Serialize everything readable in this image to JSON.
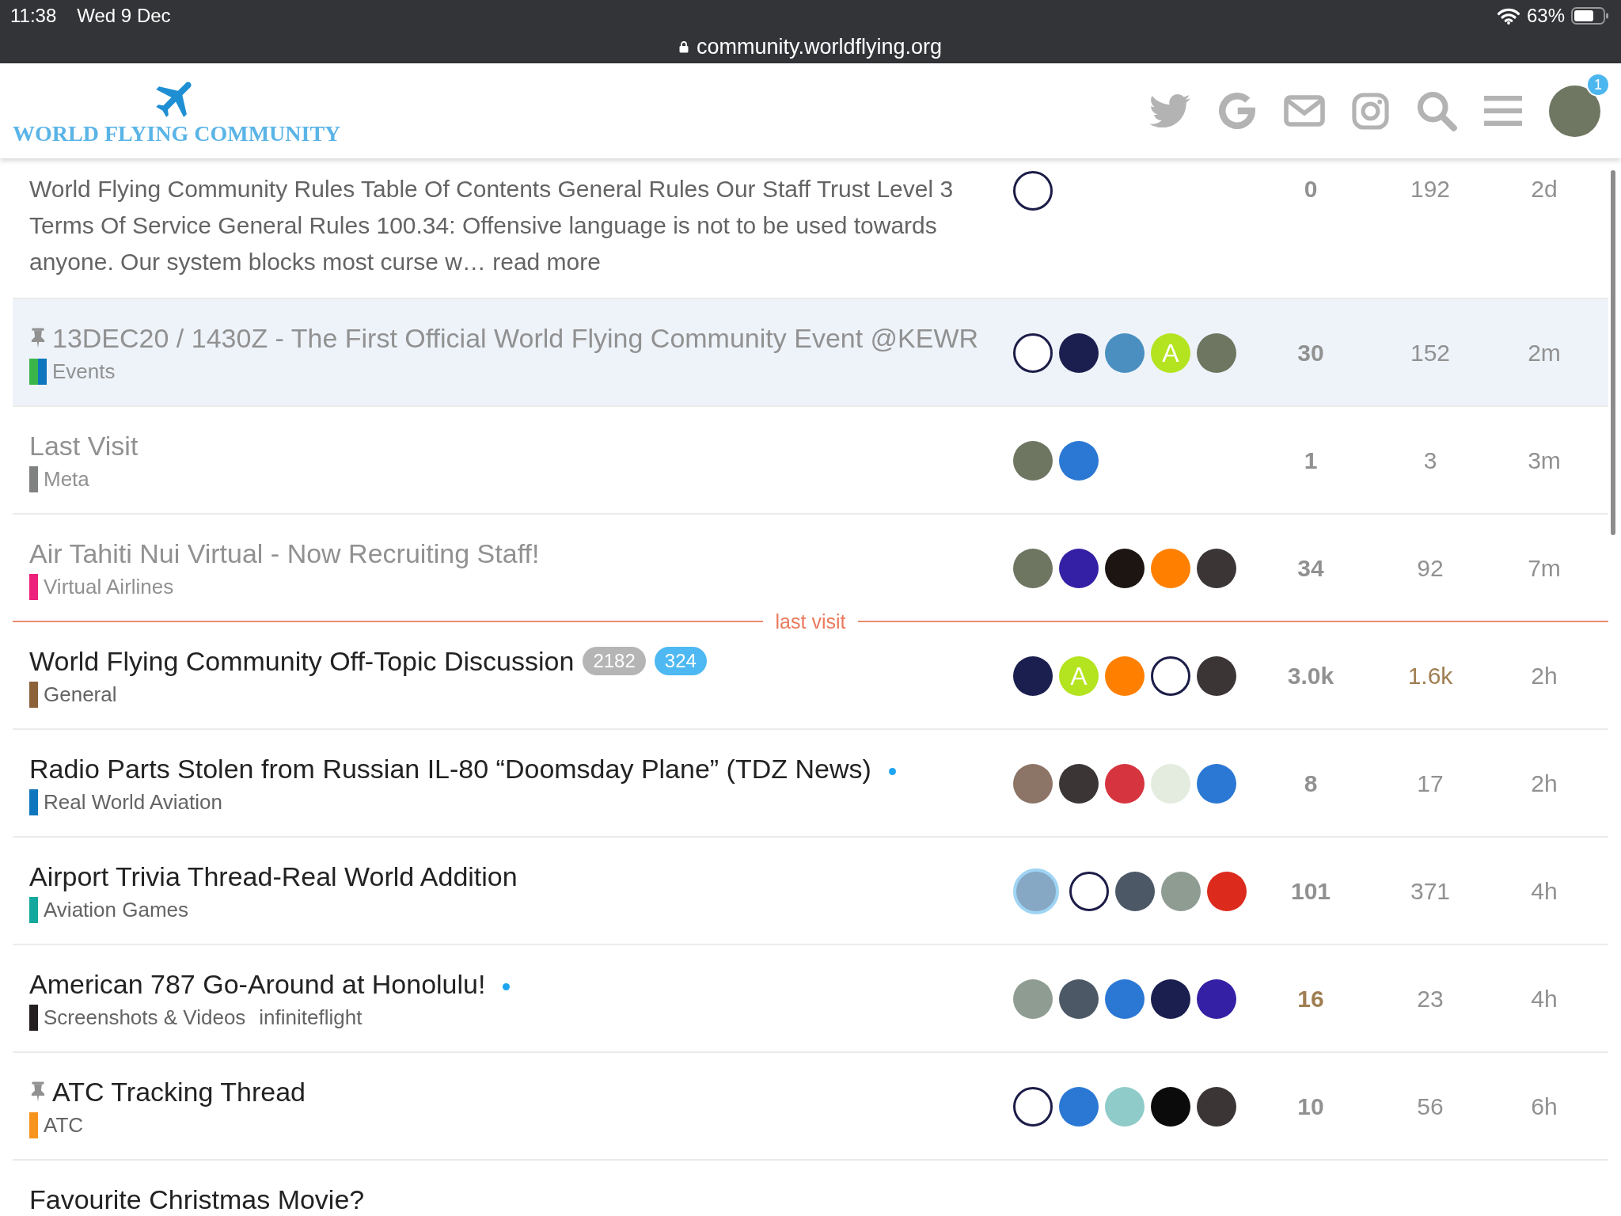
{
  "status_bar": {
    "time": "11:38",
    "date": "Wed 9 Dec",
    "url": "community.worldflying.org",
    "battery": "63%"
  },
  "header": {
    "logo_text": "WORLD FLYING COMMUNITY",
    "notification_count": "1"
  },
  "topics": [
    {
      "kind": "excerpt",
      "excerpt": "World Flying Community Rules Table Of Contents General Rules Our Staff Trust Level 3 Terms Of Service General Rules 100.34: Offensive language is not to be used towards anyone. Our system blocks most curse w…",
      "read_more": "read more",
      "highlighted": false,
      "posters": [
        {
          "kind": "ringed",
          "color": "#ffffff",
          "ring": {
            "color": "#1c1d48"
          }
        }
      ],
      "replies": "0",
      "replies_hot": false,
      "views": "192",
      "views_hot": false,
      "activity": "2d"
    },
    {
      "kind": "topic",
      "title": "13DEC20 / 1430Z - The First Official World Flying Community Event @KEWR",
      "pinned": true,
      "visited": true,
      "new": false,
      "highlighted": true,
      "category": {
        "name": "Events",
        "color": "#0e76bd",
        "parent": {
          "color": "#3ab54a"
        }
      },
      "posters": [
        {
          "kind": "ringed",
          "color": "#ffffff",
          "ring": {
            "color": "#1c1d48"
          }
        },
        {
          "kind": "photo",
          "color": "#1b1f4f"
        },
        {
          "kind": "photo",
          "color": "#4a8fc0"
        },
        {
          "kind": "letter",
          "color": "#b4e31f",
          "letter": "A"
        },
        {
          "kind": "photo",
          "color": "#6e7560"
        }
      ],
      "replies": "30",
      "replies_hot": false,
      "views": "152",
      "views_hot": false,
      "activity": "2m"
    },
    {
      "kind": "topic",
      "title": "Last Visit",
      "pinned": false,
      "visited": true,
      "new": false,
      "highlighted": false,
      "category": {
        "name": "Meta",
        "color": "#808281"
      },
      "posters": [
        {
          "kind": "photo",
          "color": "#6e7560"
        },
        {
          "kind": "photo",
          "color": "#2a78d4"
        }
      ],
      "replies": "1",
      "replies_hot": false,
      "views": "3",
      "views_hot": false,
      "activity": "3m"
    },
    {
      "kind": "topic",
      "title": "Air Tahiti Nui Virtual - Now Recruiting Staff!",
      "pinned": false,
      "visited": true,
      "new": false,
      "highlighted": false,
      "category": {
        "name": "Virtual Airlines",
        "color": "#ed207b"
      },
      "posters": [
        {
          "kind": "photo",
          "color": "#6e7560"
        },
        {
          "kind": "photo",
          "color": "#3420a5"
        },
        {
          "kind": "photo",
          "color": "#1c1512"
        },
        {
          "kind": "photo",
          "color": "#ff8000"
        },
        {
          "kind": "photo",
          "color": "#3b3536"
        }
      ],
      "replies": "34",
      "replies_hot": false,
      "views": "92",
      "views_hot": false,
      "activity": "7m"
    },
    {
      "kind": "divider",
      "label": "last visit"
    },
    {
      "kind": "topic",
      "title": "World Flying Community Off-Topic Discussion",
      "pinned": false,
      "visited": false,
      "new": false,
      "highlighted": false,
      "badges": [
        {
          "kind": "unread",
          "text": "2182"
        },
        {
          "kind": "new",
          "text": "324"
        }
      ],
      "category": {
        "name": "General",
        "color": "#8c6238"
      },
      "posters": [
        {
          "kind": "photo",
          "color": "#1b1f4f"
        },
        {
          "kind": "letter",
          "color": "#b4e31f",
          "letter": "A"
        },
        {
          "kind": "photo",
          "color": "#ff8000"
        },
        {
          "kind": "ringed",
          "color": "#ffffff",
          "ring": {
            "color": "#1c1d48"
          }
        },
        {
          "kind": "photo",
          "color": "#3b3536"
        }
      ],
      "replies": "3.0k",
      "replies_hot": false,
      "views": "1.6k",
      "views_hot": true,
      "activity": "2h"
    },
    {
      "kind": "topic",
      "title": "Radio Parts Stolen from Russian IL-80 “Doomsday Plane” (TDZ News)",
      "pinned": false,
      "visited": false,
      "new": true,
      "highlighted": false,
      "category": {
        "name": "Real World Aviation",
        "color": "#0e76bd"
      },
      "posters": [
        {
          "kind": "photo",
          "color": "#8c7466"
        },
        {
          "kind": "photo",
          "color": "#3b3536"
        },
        {
          "kind": "photo",
          "color": "#d6343f"
        },
        {
          "kind": "photo",
          "color": "#e3ecdf"
        },
        {
          "kind": "photo",
          "color": "#2a78d4"
        }
      ],
      "replies": "8",
      "replies_hot": false,
      "views": "17",
      "views_hot": false,
      "activity": "2h"
    },
    {
      "kind": "topic",
      "title": "Airport Trivia Thread-Real World Addition",
      "pinned": false,
      "visited": false,
      "new": false,
      "highlighted": false,
      "category": {
        "name": "Aviation Games",
        "color": "#12a89d"
      },
      "posters": [
        {
          "kind": "photo",
          "color": "#86a8c4",
          "highlighted": true
        },
        {
          "kind": "ringed",
          "color": "#ffffff",
          "ring": {
            "color": "#1c1d48"
          },
          "highlighted": false
        },
        {
          "kind": "photo",
          "color": "#4c5866",
          "highlighted": false
        },
        {
          "kind": "photo",
          "color": "#8f9c92",
          "highlighted": false
        },
        {
          "kind": "photo",
          "color": "#dc2a1c",
          "highlighted": false
        }
      ],
      "replies": "101",
      "replies_hot": false,
      "views": "371",
      "views_hot": false,
      "activity": "4h"
    },
    {
      "kind": "topic",
      "title": "American 787 Go-Around at Honolulu!",
      "pinned": false,
      "visited": false,
      "new": true,
      "highlighted": false,
      "category": {
        "name": "Screenshots & Videos",
        "color": "#231f20"
      },
      "tags": [
        "infiniteflight"
      ],
      "posters": [
        {
          "kind": "photo",
          "color": "#8f9c92"
        },
        {
          "kind": "photo",
          "color": "#4c5866"
        },
        {
          "kind": "photo",
          "color": "#2a78d4"
        },
        {
          "kind": "photo",
          "color": "#1b1f4f"
        },
        {
          "kind": "photo",
          "color": "#3420a5"
        }
      ],
      "replies": "16",
      "replies_hot": true,
      "views": "23",
      "views_hot": false,
      "activity": "4h"
    },
    {
      "kind": "topic",
      "title": "ATC Tracking Thread",
      "pinned": true,
      "visited": false,
      "new": false,
      "highlighted": false,
      "category": {
        "name": "ATC",
        "color": "#f7941d"
      },
      "posters": [
        {
          "kind": "ringed",
          "color": "#ffffff",
          "ring": {
            "color": "#1c1d48"
          }
        },
        {
          "kind": "photo",
          "color": "#2a78d4"
        },
        {
          "kind": "photo",
          "color": "#8ecbc9"
        },
        {
          "kind": "photo",
          "color": "#0b0b0b"
        },
        {
          "kind": "photo",
          "color": "#3b3536"
        }
      ],
      "replies": "10",
      "replies_hot": false,
      "views": "56",
      "views_hot": false,
      "activity": "6h"
    },
    {
      "kind": "topic",
      "title": "Favourite Christmas Movie?",
      "pinned": false,
      "visited": false,
      "new": false,
      "highlighted": false
    }
  ]
}
